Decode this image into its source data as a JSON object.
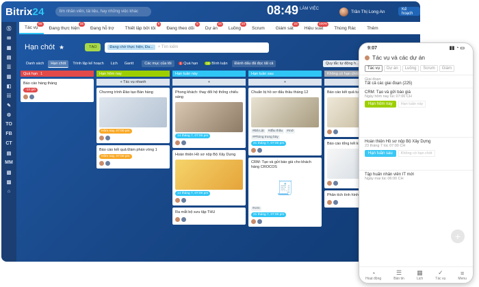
{
  "top": {
    "brand_main": "Bitrix",
    "brand_num": "24",
    "search_placeholder": "tìm nhân viên, tài liệu, hay những việc khác",
    "time": "08:49",
    "work_status": "LÀM VIỆC",
    "user_name": "Trần Thị Long An",
    "plan_btn": "Kế hoạch"
  },
  "nav": [
    {
      "label": "Tác vụ",
      "badge": "55"
    },
    {
      "label": "Đang thực hiện",
      "badge": "15"
    },
    {
      "label": "Đang hỗ trợ",
      "badge": ""
    },
    {
      "label": "Thiết lập bởi tôi",
      "badge": "8"
    },
    {
      "label": "Đang theo dõi",
      "badge": "5"
    },
    {
      "label": "Dự án",
      "badge": "15"
    },
    {
      "label": "Luồng",
      "badge": "10"
    },
    {
      "label": "Scrum",
      "badge": ""
    },
    {
      "label": "Giám sát",
      "badge": "22"
    },
    {
      "label": "Hiệu suất",
      "badge": "100%"
    },
    {
      "label": "Thùng Rác",
      "badge": ""
    },
    {
      "label": "Thêm",
      "badge": ""
    }
  ],
  "page": {
    "title": "Hạn chót",
    "tasks_pill": "TẠO",
    "filter_chip": "Đang chờ thực hiện, Đa...",
    "filter_placeholder": "+ Tìm kiếm"
  },
  "views": [
    {
      "label": "Danh sách",
      "active": false
    },
    {
      "label": "Hạn chót",
      "active": true
    },
    {
      "label": "Trình lập kế hoạch",
      "active": false
    },
    {
      "label": "Lịch",
      "active": false
    },
    {
      "label": "Gantt",
      "active": false
    }
  ],
  "viewbar_extra": {
    "filters": "Các mục của tôi",
    "overdue_badge": "1",
    "overdue": "Quá hạn",
    "comments_badge": "16",
    "comments": "Bình luận",
    "read_all": "Đánh dấu đã đọc tất cả"
  },
  "rules_btn": "Quy tắc tự động h...",
  "rail": [
    "Ⓢ",
    "✉",
    "▦",
    "▤",
    "☰",
    "▥",
    "◧",
    "☷",
    "✎",
    "⚙",
    "TO",
    "FB",
    "CT",
    "▤",
    "MM",
    "▧",
    "▨",
    "⌂"
  ],
  "columns": [
    {
      "title": "Quá hạn",
      "count": "1",
      "color": "#e24a4a",
      "add": "",
      "cards": [
        {
          "title": "Báo cáo hàng tháng",
          "deadline": "-13 giờ",
          "dl": "red",
          "img": "",
          "tags": []
        }
      ]
    },
    {
      "title": "Hạn hôm nay",
      "count": "",
      "color": "#9dcf00",
      "add": "+ Tác vụ nhanh",
      "cards": [
        {
          "title": "Chương trình Đào tạo Bán hàng",
          "deadline": "Hôm nay, 07:00 pm",
          "dl": "orange",
          "img": "img",
          "tags": []
        },
        {
          "title": "Báo cáo kết quả Đàm phán vòng 1",
          "deadline": "Hôm nay, 07:00 pm",
          "dl": "orange",
          "img": "",
          "tags": []
        }
      ]
    },
    {
      "title": "Hạn tuần này",
      "count": "",
      "color": "#2fc6f6",
      "add": "+",
      "cards": [
        {
          "title": "Phong khách: thay đổi hệ thống chiếu sáng",
          "deadline": "14 tháng 7, 07:00 pm",
          "dl": "blue",
          "img": "img room",
          "tags": []
        },
        {
          "title": "Hoàn thiện Hồ sơ nộp Bộ Xây Dựng",
          "deadline": "14 tháng 7, 07:00 pm",
          "dl": "blue",
          "img": "img hat",
          "tags": []
        },
        {
          "title": "Ra mắt bộ sưu tập THU",
          "deadline": "",
          "dl": "",
          "img": "",
          "tags": []
        }
      ]
    },
    {
      "title": "Hạn tuần sau",
      "count": "",
      "color": "#2fc6f6",
      "add": "+",
      "cards": [
        {
          "title": "Chuẩn bị hồ sơ đấu thầu tháng 12",
          "deadline": "21 tháng 7, 07:00 pm",
          "dl": "blue",
          "img": "img tender",
          "tags": [
            "#Đã Lật",
            "#đầu thầu",
            "#mở",
            "#Phòng trung bày"
          ]
        },
        {
          "title": "CRM: Tạo và gửi báo giá cho khách hàng CROCOS",
          "deadline": "21 tháng 7, 07:00 pm",
          "dl": "blue",
          "img": "receipt",
          "tags": [
            "#crm"
          ]
        }
      ]
    },
    {
      "title": "Không có hạn chót",
      "count": "",
      "color": "#a8adb4",
      "add": "+",
      "cards": [
        {
          "title": "Báo cáo kết quả tuần",
          "deadline": "",
          "dl": "",
          "img": "img doc",
          "tags": []
        },
        {
          "title": "Báo cáo tổng kết kinh doanh Quý 1",
          "deadline": "",
          "dl": "",
          "img": "img form",
          "tags": []
        },
        {
          "title": "Phân tích tình hình kinh doanh",
          "deadline": "",
          "dl": "",
          "img": "",
          "tags": []
        }
      ]
    }
  ],
  "phone": {
    "time": "9:07",
    "title": "Tác vụ và các dự án",
    "tabs": [
      "Tác vụ",
      "Dự án",
      "Luồng",
      "Scrum",
      "Giám"
    ],
    "stage_label": "Giai đoạn",
    "stage_value": "Tất cả các giai đoạn (225)",
    "t1_title": "CRM: Tạo và gửi báo giá",
    "t1_meta": "Ngày hôm nay lúc 07:00 CH",
    "t1_tag": "Hạn hôm nay",
    "t1_hint": "Hạn tuần này",
    "t2_title": "Hoàn thiện Hồ sơ nộp Bộ Xây Dựng",
    "t2_meta": "23 tháng 7 lúc 07:00 CH",
    "t2_tag": "Hạn tuần sau",
    "t2_hint": "Không có hạn chót",
    "t3_title": "Tập huấn nhân viên IT mới",
    "t3_meta": "Ngày mai lúc 06:00 CH",
    "bottom": [
      "Hoạt động",
      "Bản tin",
      "Lịch",
      "Tác vụ",
      "Menu"
    ]
  }
}
